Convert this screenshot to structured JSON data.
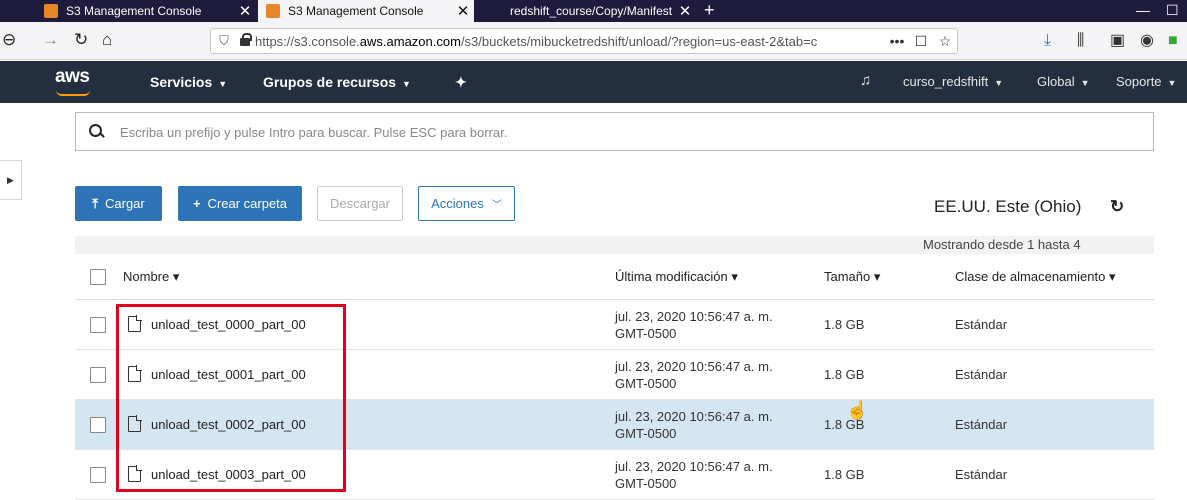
{
  "browser": {
    "tabs": [
      {
        "title": "S3 Management Console"
      },
      {
        "title": "S3 Management Console"
      },
      {
        "title": "redshift_course/Copy/Manifest"
      }
    ],
    "new_tab": "+",
    "url_prefix": "https://s3.console.",
    "url_domain": "aws.amazon.com",
    "url_path": "/s3/buckets/mibucketredshift/unload/?region=us-east-2&tab=c",
    "url_actions": [
      "•••",
      "☐",
      "☆"
    ]
  },
  "aws": {
    "logo": "aws",
    "nav": {
      "services": "Servicios",
      "resource_groups": "Grupos de recursos",
      "user": "curso_redsfhift",
      "region": "Global",
      "support": "Soporte"
    }
  },
  "search": {
    "placeholder": "Escriba un prefijo y pulse Intro para buscar. Pulse ESC para borrar."
  },
  "toolbar": {
    "upload": "Cargar",
    "create_folder": "Crear carpeta",
    "download": "Descargar",
    "actions": "Acciones",
    "region_label": "EE.UU. Este (Ohio)"
  },
  "table": {
    "showing": "Mostrando desde 1 hasta 4",
    "headers": {
      "name": "Nombre",
      "modified": "Última modificación",
      "size": "Tamaño",
      "storage_class": "Clase de almacenamiento"
    },
    "rows": [
      {
        "name": "unload_test_0000_part_00",
        "date_line1": "jul. 23, 2020 10:56:47 a. m.",
        "date_line2": "GMT-0500",
        "size": "1.8 GB",
        "storage_class": "Estándar"
      },
      {
        "name": "unload_test_0001_part_00",
        "date_line1": "jul. 23, 2020 10:56:47 a. m.",
        "date_line2": "GMT-0500",
        "size": "1.8 GB",
        "storage_class": "Estándar"
      },
      {
        "name": "unload_test_0002_part_00",
        "date_line1": "jul. 23, 2020 10:56:47 a. m.",
        "date_line2": "GMT-0500",
        "size": "1.8 GB",
        "storage_class": "Estándar"
      },
      {
        "name": "unload_test_0003_part_00",
        "date_line1": "jul. 23, 2020 10:56:47 a. m.",
        "date_line2": "GMT-0500",
        "size": "1.8 GB",
        "storage_class": "Estándar"
      }
    ]
  },
  "colors": {
    "aws_header": "#232f3e",
    "primary": "#2e73b8",
    "highlight_row": "#d5e6f3",
    "annotation": "#e3001b"
  }
}
